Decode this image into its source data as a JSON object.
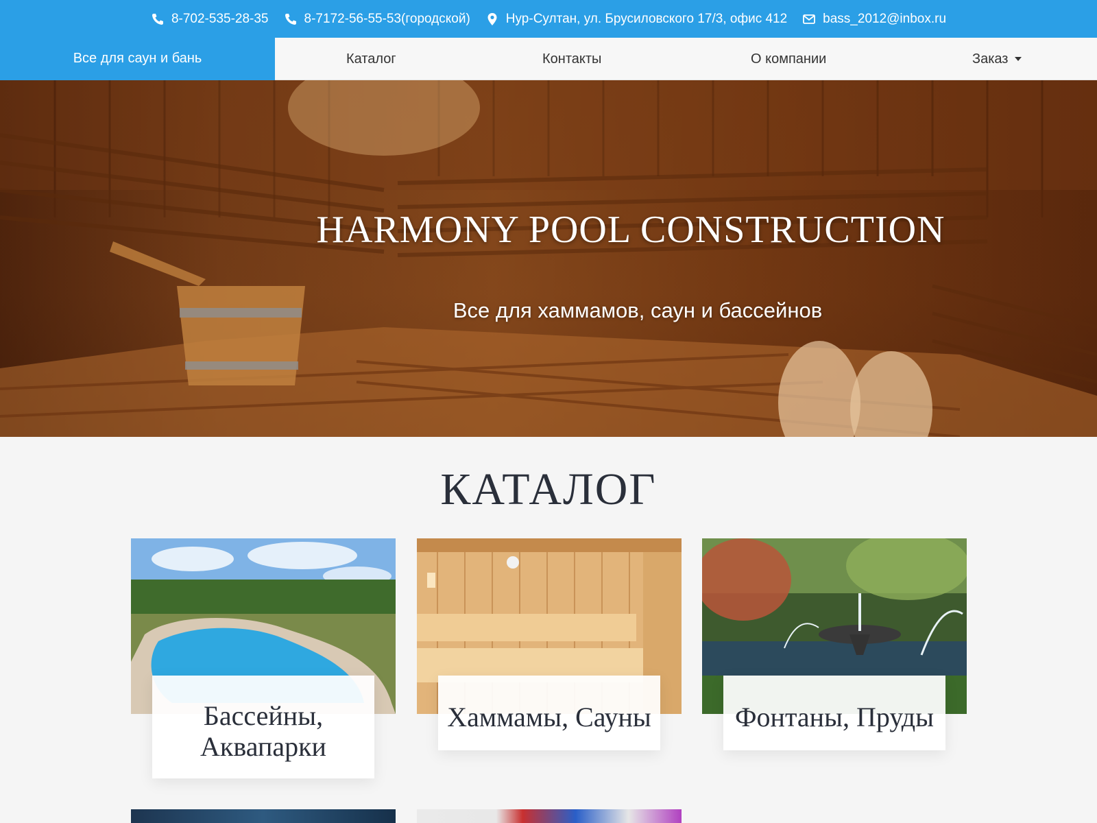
{
  "topbar": {
    "phone1": "8-702-535-28-35",
    "phone2": "8-7172-56-55-53(городской)",
    "address": "Нур-Султан, ул. Брусиловского 17/3, офис 412",
    "email": "bass_2012@inbox.ru"
  },
  "nav": {
    "brand": "Все для саун и бань",
    "items": [
      "Каталог",
      "Контакты",
      "О компании",
      "Заказ"
    ]
  },
  "hero": {
    "title": "HARMONY POOL CONSTRUCTION",
    "subtitle": "Все для хаммамов, саун и бассейнов"
  },
  "catalog": {
    "heading": "КАТАЛОГ",
    "cards": [
      {
        "line1": "Бассейны,",
        "line2": "Аквапарки"
      },
      {
        "line1": "Хаммамы, Сауны"
      },
      {
        "line1": "Фонтаны, Пруды"
      }
    ]
  },
  "colors": {
    "accent": "#2b9fe6",
    "heading": "#2a2f3a",
    "background": "#f5f5f5"
  }
}
